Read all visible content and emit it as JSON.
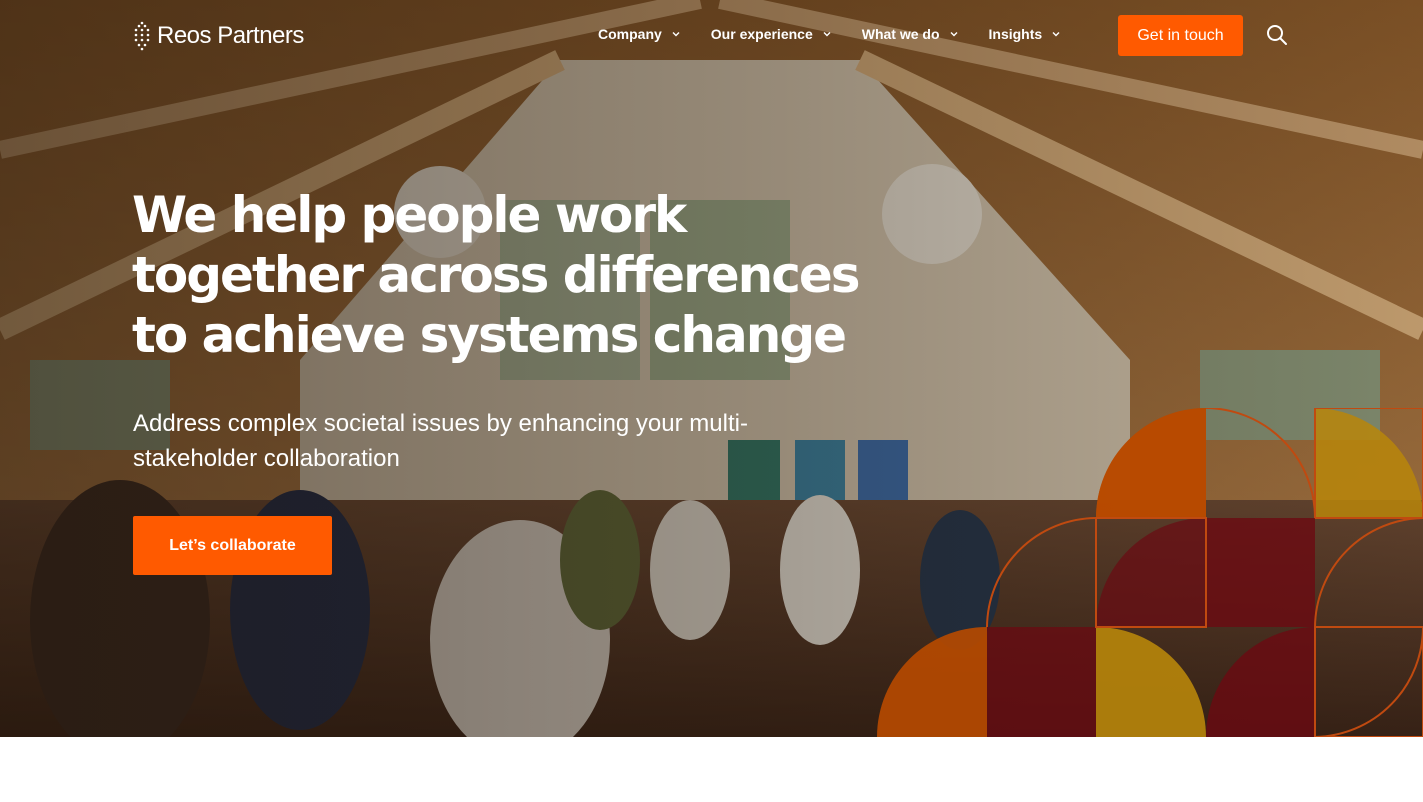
{
  "brand": {
    "name": "Reos Partners",
    "logo_icon": "reos-leaf-mark"
  },
  "nav": {
    "items": [
      {
        "label": "Company",
        "icon": "chevron-down-icon"
      },
      {
        "label": "Our experience",
        "icon": "chevron-down-icon"
      },
      {
        "label": "What we do",
        "icon": "chevron-down-icon"
      },
      {
        "label": "Insights",
        "icon": "chevron-down-icon"
      }
    ],
    "cta_label": "Get in touch",
    "search_icon": "search-icon"
  },
  "hero": {
    "headline": "We help people work together across differences to achieve systems change",
    "subheadline": "Address complex societal issues by enhancing your multi-stakeholder collaboration",
    "cta_label": "Let’s collaborate"
  },
  "colors": {
    "accent": "#ff5a00",
    "pattern_orange": "#b84a00",
    "pattern_gold": "#b8860b",
    "pattern_maroon": "#6b0a12",
    "text_on_hero": "#ffffff"
  }
}
